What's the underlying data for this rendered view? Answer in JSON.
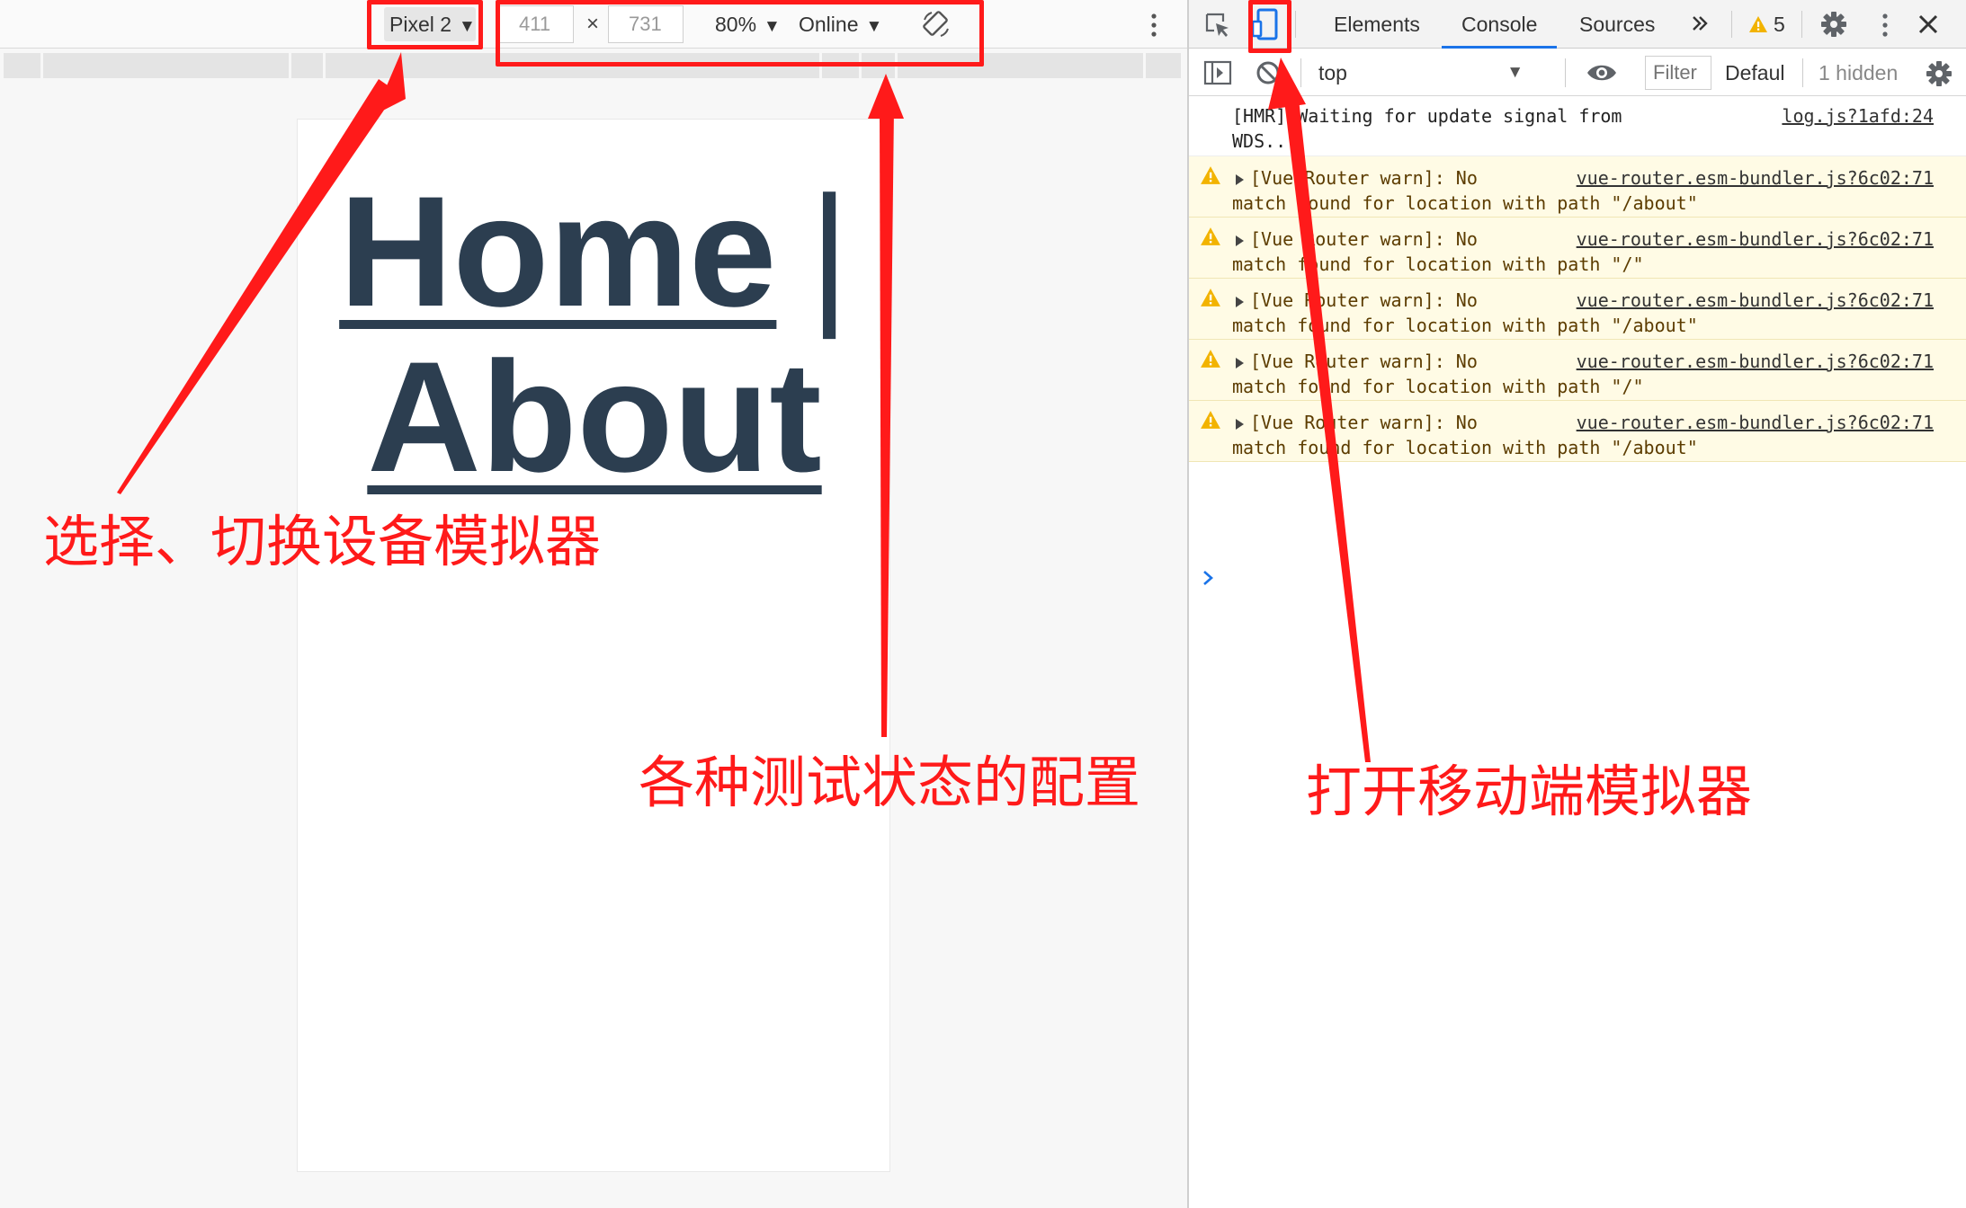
{
  "device_toolbar": {
    "device": "Pixel 2",
    "width": "411",
    "times": "×",
    "height": "731",
    "zoom": "80%",
    "network": "Online",
    "icons": [
      "rotate-icon",
      "more-vertical-icon"
    ]
  },
  "page": {
    "home_link": "Home",
    "separator": "|",
    "about_link": "About",
    "text_color": "#2c3e50"
  },
  "devtools": {
    "tabs": [
      "Elements",
      "Console",
      "Sources"
    ],
    "active_tab": "Console",
    "warning_count": "5",
    "icons": [
      "inspect-element-icon",
      "device-toggle-icon",
      "double-chevron-right-icon",
      "warning-icon",
      "gear-icon",
      "more-vertical-icon",
      "close-icon"
    ]
  },
  "console_toolbar": {
    "context": "top",
    "filter_placeholder": "Filter",
    "levels": "Defaul",
    "hidden": "1 hidden",
    "icons": [
      "sidebar-toggle-icon",
      "clear-console-icon",
      "eye-icon",
      "gear-icon"
    ]
  },
  "console": {
    "messages": [
      {
        "level": "info",
        "line1": "[HMR] Waiting for update signal from",
        "line2": "WDS...",
        "source": "log.js?1afd:24"
      },
      {
        "level": "warning",
        "line1": "[Vue Router warn]: No",
        "line2": "match found for location with path \"/about\"",
        "source": "vue-router.esm-bundler.js?6c02:71"
      },
      {
        "level": "warning",
        "line1": "[Vue Router warn]: No",
        "line2": "match found for location with path \"/\"",
        "source": "vue-router.esm-bundler.js?6c02:71"
      },
      {
        "level": "warning",
        "line1": "[Vue Router warn]: No",
        "line2": "match found for location with path \"/about\"",
        "source": "vue-router.esm-bundler.js?6c02:71"
      },
      {
        "level": "warning",
        "line1": "[Vue Router warn]: No",
        "line2": "match found for location with path \"/\"",
        "source": "vue-router.esm-bundler.js?6c02:71"
      },
      {
        "level": "warning",
        "line1": "[Vue Router warn]: No",
        "line2": "match found for location with path \"/about\"",
        "source": "vue-router.esm-bundler.js?6c02:71"
      }
    ]
  },
  "annotations": {
    "color": "#ff1a1a",
    "device_select": "选择、切换设备模拟器",
    "test_config": "各种测试状态的配置",
    "open_mobile": "打开移动端模拟器"
  },
  "colors": {
    "accent": "#1a73e8",
    "warning_bg": "#fffbe5",
    "warning_icon": "#f2b300"
  }
}
